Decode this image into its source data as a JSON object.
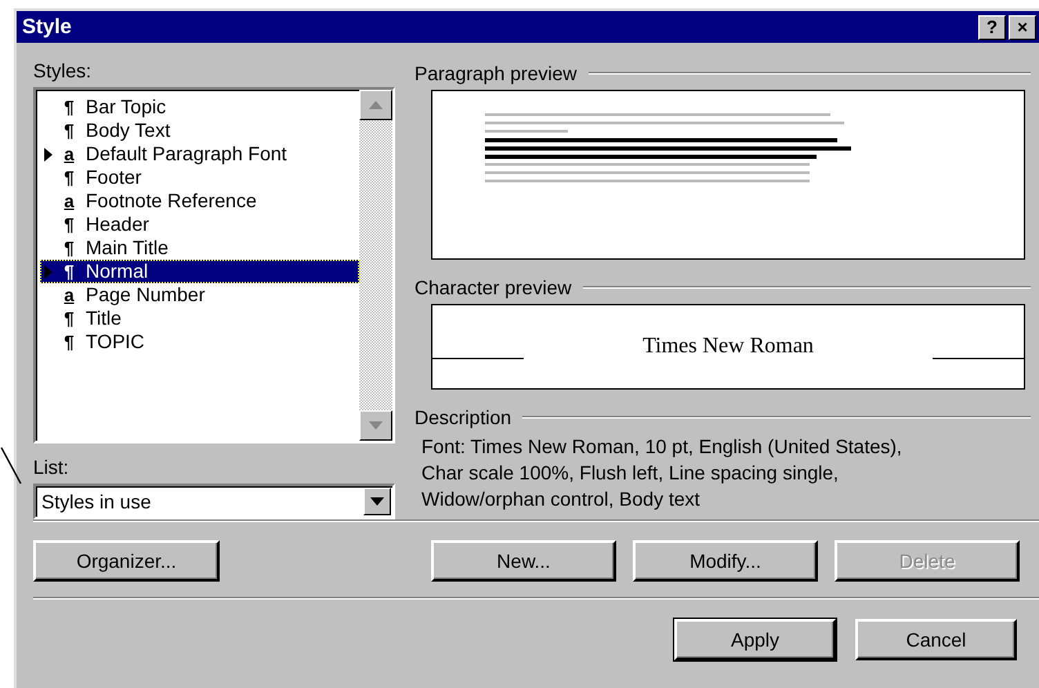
{
  "window": {
    "title": "Style",
    "help_button": "?",
    "close_button": "×"
  },
  "styles_label": "Styles:",
  "styles": [
    {
      "kind": "paragraph",
      "glyph": "¶",
      "name": "Bar Topic",
      "marked": false,
      "selected": false
    },
    {
      "kind": "paragraph",
      "glyph": "¶",
      "name": "Body Text",
      "marked": false,
      "selected": false
    },
    {
      "kind": "character",
      "glyph": "a",
      "name": "Default Paragraph Font",
      "marked": true,
      "selected": false
    },
    {
      "kind": "paragraph",
      "glyph": "¶",
      "name": "Footer",
      "marked": false,
      "selected": false
    },
    {
      "kind": "character",
      "glyph": "a",
      "name": "Footnote Reference",
      "marked": false,
      "selected": false
    },
    {
      "kind": "paragraph",
      "glyph": "¶",
      "name": "Header",
      "marked": false,
      "selected": false
    },
    {
      "kind": "paragraph",
      "glyph": "¶",
      "name": "Main Title",
      "marked": false,
      "selected": false
    },
    {
      "kind": "paragraph",
      "glyph": "¶",
      "name": "Normal",
      "marked": true,
      "selected": true
    },
    {
      "kind": "character",
      "glyph": "a",
      "name": "Page Number",
      "marked": false,
      "selected": false
    },
    {
      "kind": "paragraph",
      "glyph": "¶",
      "name": "Title",
      "marked": false,
      "selected": false
    },
    {
      "kind": "paragraph",
      "glyph": "¶",
      "name": "TOPIC",
      "marked": false,
      "selected": false
    }
  ],
  "list_label": "List:",
  "list_value": "Styles in use",
  "paragraph_preview": {
    "label": "Paragraph preview"
  },
  "character_preview": {
    "label": "Character preview",
    "sample": "Times New Roman"
  },
  "description": {
    "label": "Description",
    "text": "Font: Times New Roman, 10 pt, English (United States), Char scale 100%, Flush left, Line spacing single, Widow/orphan control, Body text"
  },
  "organizer_button": {
    "label": "Organizer...",
    "disabled": false,
    "default": false
  },
  "style_buttons": [
    {
      "label": "New...",
      "disabled": false,
      "default": false
    },
    {
      "label": "Modify...",
      "disabled": false,
      "default": false
    },
    {
      "label": "Delete",
      "disabled": true,
      "default": false
    }
  ],
  "dialog_buttons": [
    {
      "label": "Apply",
      "disabled": false,
      "default": true
    },
    {
      "label": "Cancel",
      "disabled": false,
      "default": false
    }
  ]
}
